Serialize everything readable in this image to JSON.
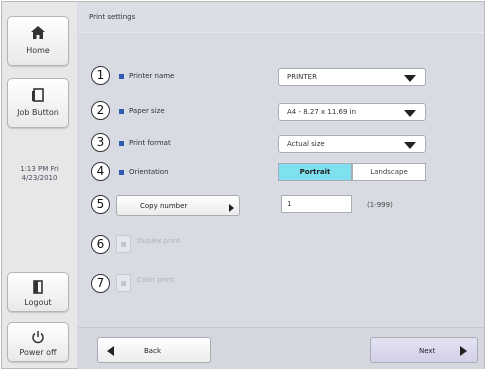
{
  "sidebar": {
    "home_label": "Home",
    "home_icon": "home-icon",
    "job_label": "Job Button",
    "job_icon": "document-icon",
    "clock_time": "1:13 PM  Fri",
    "clock_date": "4/23/2010",
    "logout_label": "Logout",
    "logout_icon": "logout-icon",
    "power_label": "Power off",
    "power_icon": "power-icon"
  },
  "title": "Print settings",
  "settings": {
    "printer": {
      "num": "1",
      "label": "Printer name",
      "value": "PRINTER"
    },
    "paper": {
      "num": "2",
      "label": "Paper size",
      "value": "A4 - 8.27 x 11.69 in"
    },
    "format": {
      "num": "3",
      "label": "Print format",
      "value": "Actual size"
    },
    "orientation": {
      "num": "4",
      "label": "Orientation",
      "options": [
        "Portrait",
        "Landscape"
      ],
      "selected": "Portrait"
    },
    "copies": {
      "num": "5",
      "button_label": "Copy number",
      "value": "1",
      "range": "(1-999)"
    },
    "duplex": {
      "num": "6",
      "label": "Duplex print"
    },
    "color": {
      "num": "7",
      "label": "Color print"
    }
  },
  "footer": {
    "back_label": "Back",
    "next_label": "Next"
  },
  "colors": {
    "accent": "#7fe0f0",
    "bullet": "#2f5bb5",
    "background": "#d9dbe3"
  }
}
